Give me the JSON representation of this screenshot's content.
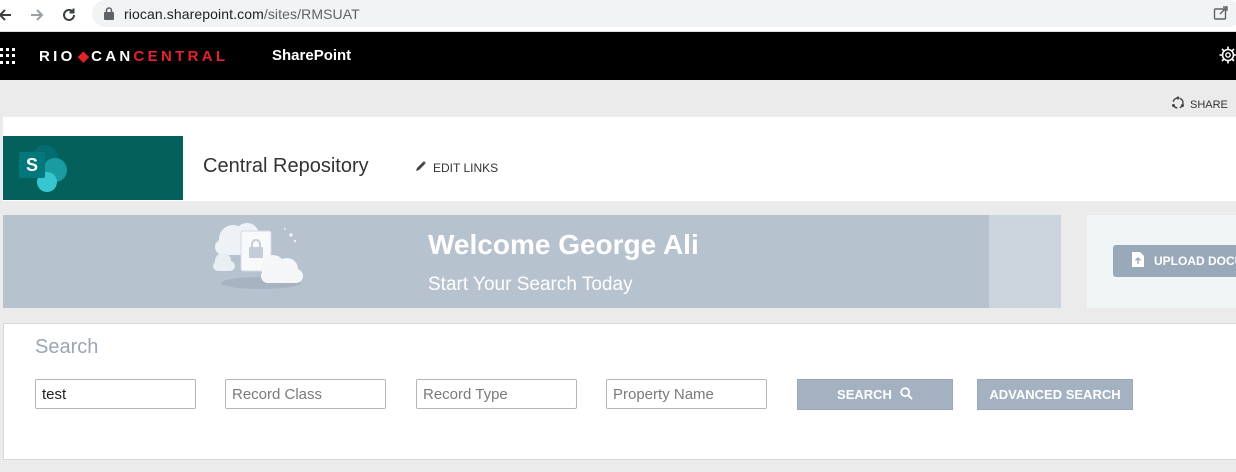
{
  "browser": {
    "url_host": "riocan.sharepoint.com",
    "url_path": "/sites/RMSUAT"
  },
  "suite_bar": {
    "brand_rio": "RIO",
    "brand_dot": "◆",
    "brand_can": "CAN",
    "brand_central": "CENTRAL",
    "app_name": "SharePoint"
  },
  "share_label": "SHARE",
  "header": {
    "logo_letter": "S",
    "site_title": "Central Repository",
    "edit_links": "EDIT LINKS"
  },
  "banner": {
    "welcome": "Welcome George Ali",
    "subtitle": "Start Your Search Today",
    "upload_label": "UPLOAD DOCU"
  },
  "search": {
    "heading": "Search",
    "query_value": "test",
    "record_class_placeholder": "Record Class",
    "record_type_placeholder": "Record Type",
    "property_name_placeholder": "Property Name",
    "search_label": "SEARCH",
    "advanced_label": "ADVANCED SEARCH"
  },
  "colors": {
    "suite_bar": "#000000",
    "brand_red": "#e4222e",
    "logo_tile": "#03605a",
    "banner": "#b7c2cf",
    "button": "#a3b1c1"
  }
}
